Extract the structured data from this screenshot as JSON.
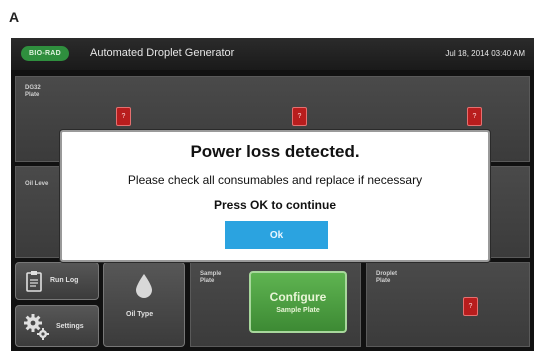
{
  "figure": {
    "panel_letter": "A"
  },
  "app": {
    "logo_text": "BIO-RAD",
    "title": "Automated Droplet Generator",
    "datetime": "Jul 18, 2014 03:40 AM"
  },
  "background": {
    "dg32_plate_label_line1": "DG32",
    "dg32_plate_label_line2": "Plate",
    "oil_level_label": "Oil Leve",
    "badge_text": "?"
  },
  "bottom": {
    "run_log_label": "Run Log",
    "settings_label": "Settings",
    "oil_type_label": "Oil Type",
    "sample_plate_line1": "Sample",
    "sample_plate_line2": "Plate",
    "configure_label": "Configure",
    "configure_sub": "Sample Plate",
    "droplet_plate_line1": "Droplet",
    "droplet_plate_line2": "Plate"
  },
  "dialog": {
    "title": "Power loss detected.",
    "message": "Please check all consumables and replace if necessary",
    "prompt": "Press OK to continue",
    "ok_label": "Ok"
  },
  "colors": {
    "dialog_ok": "#2ba3e0",
    "configure": "#4c9e41",
    "badge": "#b81d1d",
    "logo": "#2f8f3e"
  }
}
